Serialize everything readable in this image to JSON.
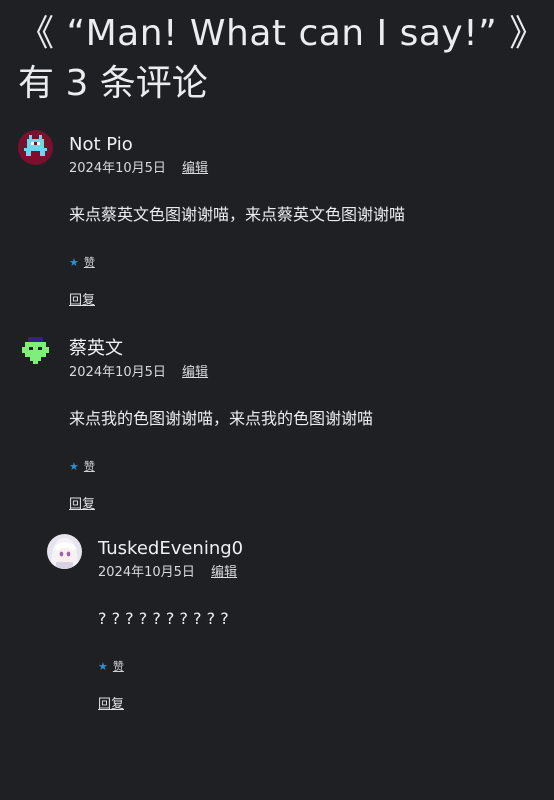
{
  "post": {
    "title": "《 “Man! What can I say!” 》"
  },
  "comments_heading": "有 3 条评论",
  "comments": [
    {
      "author": "Not Pio",
      "date": "2024年10月5日",
      "edit_label": "编辑",
      "content": "来点蔡英文色图谢谢喵，来点蔡英文色图谢谢喵",
      "like_label": "赞",
      "reply_label": "回复",
      "avatar": {
        "kind": "pixel",
        "bg": "#7a0f2e",
        "fg": "#6fd6f0"
      }
    },
    {
      "author": "蔡英文",
      "date": "2024年10月5日",
      "edit_label": "编辑",
      "content": "来点我的色图谢谢喵，来点我的色图谢谢喵",
      "like_label": "赞",
      "reply_label": "回复",
      "avatar": {
        "kind": "pixel",
        "bg": "#1f2023",
        "fg": "#7ef07a",
        "accent": "#3a1d8a"
      }
    },
    {
      "author": "TuskedEvening0",
      "date": "2024年10月5日",
      "edit_label": "编辑",
      "content": "? ? ? ? ? ? ? ? ? ?",
      "like_label": "赞",
      "reply_label": "回复",
      "avatar": {
        "kind": "photo",
        "bg": "#e8e4ee"
      }
    }
  ],
  "colors": {
    "background": "#1f2023",
    "text": "#ececee",
    "star": "#2e8fd1"
  },
  "icons": {
    "like": "star-icon"
  }
}
